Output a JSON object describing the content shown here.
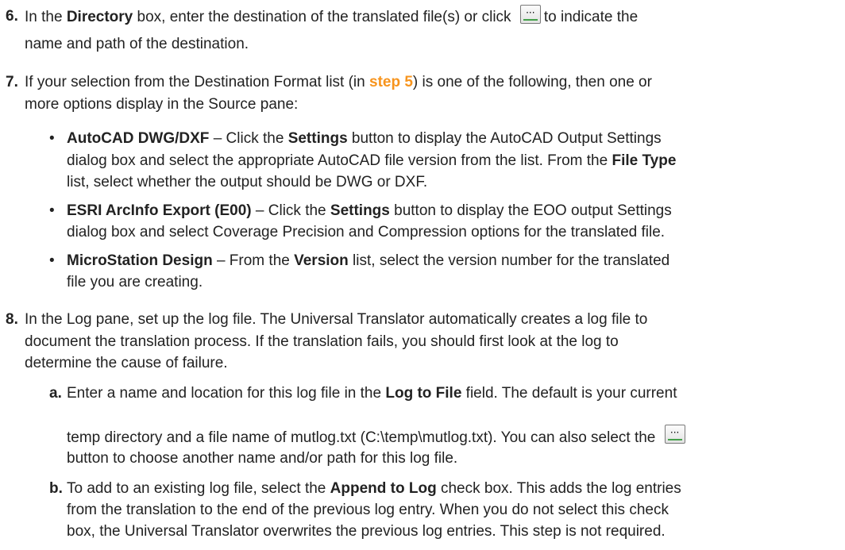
{
  "glyphs": {
    "bullet": "•"
  },
  "icons": {
    "browse_glyph": "···",
    "browse_icon": "ellipsis-browse-icon"
  },
  "colors": {
    "link": "#F7941D",
    "text": "#222222"
  },
  "steps": {
    "s6": {
      "num": "6.",
      "l1a": "In the ",
      "l1b": "Directory",
      "l1c": " box, enter the destination of the translated file(s) or click",
      "l1d": "to indicate the",
      "l2": "name and path of the destination."
    },
    "s7": {
      "num": "7.",
      "l1a": "If your selection from the Destination Format list (in ",
      "l1link": "step 5",
      "l1c": ") is one of the following, then one or",
      "l2": "more options display in the Source pane:",
      "b1": {
        "l1a": "AutoCAD DWG/DXF",
        "l1b": " – Click the ",
        "l1c": "Settings",
        "l1d": " button to display the AutoCAD Output Settings",
        "l2a": "dialog box and select the appropriate AutoCAD file version from the list. From the ",
        "l2b": "File Type",
        "l3": "list, select whether the output should be DWG or DXF."
      },
      "b2": {
        "l1a": "ESRI ArcInfo Export (E00)",
        "l1b": " – Click the ",
        "l1c": "Settings",
        "l1d": " button to display the EOO output Settings",
        "l2": "dialog box and select Coverage Precision and Compression options for the translated file."
      },
      "b3": {
        "l1a": "MicroStation Design",
        "l1b": " – From the ",
        "l1c": "Version",
        "l1d": " list, select the version number for the translated",
        "l2": "file you are creating."
      }
    },
    "s8": {
      "num": "8.",
      "l1": "In the Log pane, set up the log file. The Universal Translator automatically creates a log file to",
      "l2": "document the translation process. If the translation fails, you should first look at the log to",
      "l3": "determine the cause of failure.",
      "a": {
        "num": "a.",
        "l1a": "Enter a name and location for this log file in the ",
        "l1b": "Log to File",
        "l1c": " field. The default is your current",
        "l2": "temp directory and a file name of mutlog.txt (C:\\temp\\mutlog.txt). You can also select the",
        "l3": "button to choose another name and/or path for this log file."
      },
      "b": {
        "num": "b.",
        "l1a": "To add to an existing log file, select the ",
        "l1b": "Append to Log",
        "l1c": " check box. This adds the log entries",
        "l2": "from the translation to the end of the previous log entry. When you do not select this check",
        "l3": "box, the Universal Translator overwrites the previous log entries. This step is not required."
      }
    }
  }
}
